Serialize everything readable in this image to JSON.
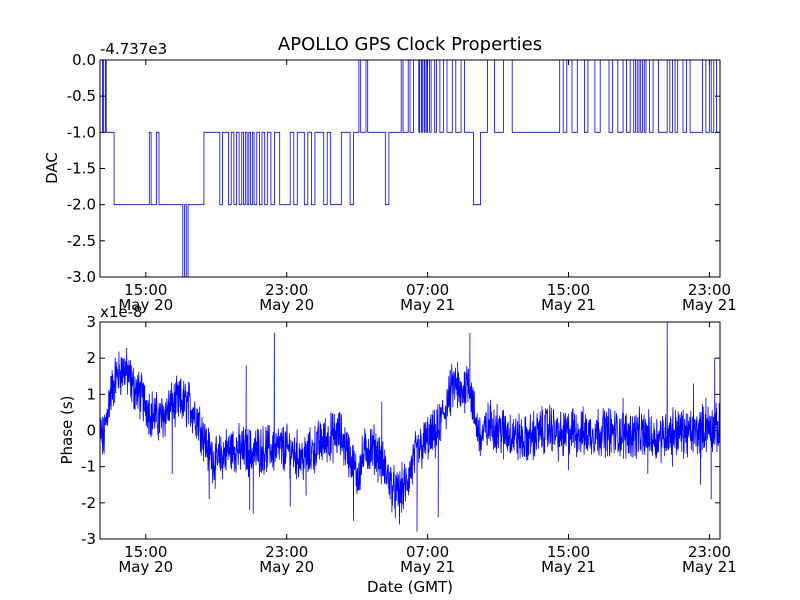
{
  "figure": {
    "title": "APOLLO GPS Clock Properties",
    "xlabel": "Date (GMT)"
  },
  "x_ticks": [
    {
      "time": "15:00",
      "date": "May 20",
      "hours": 15
    },
    {
      "time": "23:00",
      "date": "May 20",
      "hours": 23
    },
    {
      "time": "07:00",
      "date": "May 21",
      "hours": 31
    },
    {
      "time": "15:00",
      "date": "May 21",
      "hours": 39
    },
    {
      "time": "23:00",
      "date": "May 21",
      "hours": 47
    }
  ],
  "chart_data": [
    {
      "type": "line",
      "name": "dac-chart",
      "ylabel": "DAC",
      "offset_label": "-4.737e3",
      "xlim_hours": [
        12.4,
        47.6
      ],
      "ylim": [
        -3.0,
        0.0
      ],
      "yticks": [
        0.0,
        -0.5,
        -1.0,
        -1.5,
        -2.0,
        -2.5,
        -3.0
      ],
      "ytick_labels": [
        "0.0",
        "-0.5",
        "-1.0",
        "-1.5",
        "-2.0",
        "-2.5",
        "-3.0"
      ],
      "color": "#0000ff",
      "steps": [
        [
          12.4,
          -1
        ],
        [
          12.55,
          0
        ],
        [
          12.6,
          -1
        ],
        [
          12.7,
          0
        ],
        [
          12.75,
          -1
        ],
        [
          13.2,
          -2
        ],
        [
          15.2,
          -1
        ],
        [
          15.3,
          -2
        ],
        [
          15.6,
          -1
        ],
        [
          15.75,
          -2
        ],
        [
          17.1,
          -3
        ],
        [
          17.2,
          -2
        ],
        [
          17.3,
          -3
        ],
        [
          17.4,
          -2
        ],
        [
          18.3,
          -1
        ],
        [
          19.2,
          -2
        ],
        [
          19.35,
          -1
        ],
        [
          19.7,
          -2
        ],
        [
          19.85,
          -1
        ],
        [
          20.0,
          -2
        ],
        [
          20.15,
          -1
        ],
        [
          20.3,
          -2
        ],
        [
          20.45,
          -1
        ],
        [
          20.55,
          -2
        ],
        [
          20.65,
          -1
        ],
        [
          20.75,
          -2
        ],
        [
          20.85,
          -1
        ],
        [
          20.95,
          -2
        ],
        [
          21.05,
          -1
        ],
        [
          21.15,
          -2
        ],
        [
          21.3,
          -1
        ],
        [
          21.45,
          -2
        ],
        [
          21.6,
          -1
        ],
        [
          21.75,
          -2
        ],
        [
          21.9,
          -1
        ],
        [
          22.1,
          -2
        ],
        [
          22.3,
          -1
        ],
        [
          22.6,
          -2
        ],
        [
          23.2,
          -1
        ],
        [
          23.4,
          -2
        ],
        [
          23.6,
          -1
        ],
        [
          24.0,
          -2
        ],
        [
          24.2,
          -1
        ],
        [
          24.4,
          -2
        ],
        [
          24.6,
          -1
        ],
        [
          25.1,
          -2
        ],
        [
          25.3,
          -1
        ],
        [
          25.5,
          -2
        ],
        [
          26.1,
          -1
        ],
        [
          26.6,
          -2
        ],
        [
          26.8,
          -1
        ],
        [
          27.0,
          -1
        ],
        [
          27.1,
          0
        ],
        [
          27.2,
          -1
        ],
        [
          27.5,
          0
        ],
        [
          27.6,
          -1
        ],
        [
          28.6,
          -2
        ],
        [
          28.8,
          -1
        ],
        [
          29.5,
          0
        ],
        [
          29.6,
          -1
        ],
        [
          29.9,
          0
        ],
        [
          30.0,
          -1
        ],
        [
          30.2,
          0
        ],
        [
          30.5,
          -1
        ],
        [
          30.55,
          0
        ],
        [
          30.65,
          -1
        ],
        [
          30.7,
          0
        ],
        [
          30.8,
          -1
        ],
        [
          30.85,
          0
        ],
        [
          30.95,
          -1
        ],
        [
          31.0,
          0
        ],
        [
          31.1,
          -1
        ],
        [
          31.2,
          0
        ],
        [
          31.4,
          -1
        ],
        [
          31.5,
          0
        ],
        [
          31.7,
          -1
        ],
        [
          31.9,
          0
        ],
        [
          32.1,
          -1
        ],
        [
          32.4,
          0
        ],
        [
          32.6,
          -1
        ],
        [
          32.9,
          0
        ],
        [
          33.1,
          -1
        ],
        [
          33.6,
          -2
        ],
        [
          34.0,
          -1
        ],
        [
          34.4,
          0
        ],
        [
          34.8,
          -1
        ],
        [
          35.3,
          0
        ],
        [
          35.8,
          -1
        ],
        [
          38.5,
          0
        ],
        [
          38.7,
          -1
        ],
        [
          38.9,
          0
        ],
        [
          39.2,
          -1
        ],
        [
          39.5,
          0
        ],
        [
          39.9,
          -1
        ],
        [
          40.1,
          0
        ],
        [
          40.5,
          -1
        ],
        [
          40.8,
          0
        ],
        [
          41.3,
          -1
        ],
        [
          41.5,
          0
        ],
        [
          41.8,
          -1
        ],
        [
          42.1,
          0
        ],
        [
          42.3,
          -1
        ],
        [
          42.5,
          0
        ],
        [
          42.7,
          -1
        ],
        [
          42.8,
          0
        ],
        [
          42.9,
          -1
        ],
        [
          43.0,
          0
        ],
        [
          43.1,
          -1
        ],
        [
          43.2,
          0
        ],
        [
          43.3,
          -1
        ],
        [
          43.4,
          0
        ],
        [
          43.6,
          -1
        ],
        [
          43.8,
          0
        ],
        [
          44.1,
          -1
        ],
        [
          44.6,
          0
        ],
        [
          44.75,
          -1
        ],
        [
          44.9,
          0
        ],
        [
          45.05,
          -1
        ],
        [
          45.2,
          0
        ],
        [
          45.5,
          -1
        ],
        [
          45.7,
          0
        ],
        [
          45.9,
          -1
        ],
        [
          46.6,
          0
        ],
        [
          46.8,
          -1
        ],
        [
          47.0,
          0
        ],
        [
          47.1,
          -1
        ],
        [
          47.25,
          0
        ],
        [
          47.4,
          -1
        ],
        [
          47.6,
          -1
        ]
      ]
    },
    {
      "type": "line",
      "name": "phase-chart",
      "ylabel": "Phase (s)",
      "offset_label": "x1e-8",
      "xlim_hours": [
        12.4,
        47.6
      ],
      "ylim": [
        -3,
        3
      ],
      "yticks": [
        3,
        2,
        1,
        0,
        -1,
        -2,
        -3
      ],
      "ytick_labels": [
        "3",
        "2",
        "1",
        "0",
        "-1",
        "-2",
        "-3"
      ],
      "color": "#0000ff",
      "trend": [
        [
          12.4,
          0
        ],
        [
          12.6,
          -0.3
        ],
        [
          12.9,
          0.8
        ],
        [
          13.3,
          1.5
        ],
        [
          13.8,
          1.7
        ],
        [
          14.3,
          1.2
        ],
        [
          14.8,
          0.9
        ],
        [
          15.3,
          0.5
        ],
        [
          15.8,
          0.3
        ],
        [
          16.3,
          0.6
        ],
        [
          16.9,
          0.8
        ],
        [
          17.5,
          0.7
        ],
        [
          18.0,
          0.3
        ],
        [
          18.5,
          -0.5
        ],
        [
          19.0,
          -0.9
        ],
        [
          19.5,
          -0.6
        ],
        [
          20.0,
          -0.5
        ],
        [
          21.0,
          -0.6
        ],
        [
          22.0,
          -0.5
        ],
        [
          23.0,
          -0.5
        ],
        [
          24.0,
          -0.8
        ],
        [
          25.0,
          -0.3
        ],
        [
          26.0,
          -0.1
        ],
        [
          26.5,
          -0.6
        ],
        [
          27.0,
          -1.3
        ],
        [
          27.5,
          -0.5
        ],
        [
          28.0,
          -0.5
        ],
        [
          28.5,
          -1.0
        ],
        [
          29.2,
          -1.8
        ],
        [
          29.8,
          -1.5
        ],
        [
          30.3,
          -0.7
        ],
        [
          30.9,
          -0.3
        ],
        [
          31.5,
          -0.1
        ],
        [
          32.0,
          0.6
        ],
        [
          32.5,
          1.3
        ],
        [
          32.9,
          0.9
        ],
        [
          33.3,
          1.5
        ],
        [
          33.7,
          0.3
        ],
        [
          34.0,
          -0.2
        ],
        [
          34.6,
          0.2
        ],
        [
          35.2,
          0.0
        ],
        [
          35.8,
          -0.1
        ],
        [
          36.5,
          -0.3
        ],
        [
          37.2,
          -0.1
        ],
        [
          38.0,
          0.1
        ],
        [
          38.5,
          -0.2
        ],
        [
          39.2,
          0.0
        ],
        [
          40.0,
          -0.1
        ],
        [
          41.0,
          0.0
        ],
        [
          42.0,
          -0.1
        ],
        [
          43.0,
          -0.1
        ],
        [
          44.0,
          -0.2
        ],
        [
          45.0,
          0.0
        ],
        [
          46.0,
          -0.1
        ],
        [
          47.0,
          0.1
        ],
        [
          47.6,
          0.0
        ]
      ],
      "spikes": [
        [
          13.6,
          2.0
        ],
        [
          16.5,
          -1.2
        ],
        [
          18.6,
          -1.9
        ],
        [
          20.7,
          1.8
        ],
        [
          20.9,
          -2.2
        ],
        [
          21.1,
          -2.3
        ],
        [
          22.3,
          2.7
        ],
        [
          23.2,
          -2.1
        ],
        [
          24.1,
          -1.8
        ],
        [
          26.8,
          -2.5
        ],
        [
          28.4,
          0.8
        ],
        [
          29.4,
          -2.6
        ],
        [
          30.4,
          -2.8
        ],
        [
          31.6,
          -2.4
        ],
        [
          32.7,
          1.9
        ],
        [
          33.4,
          2.7
        ],
        [
          35.3,
          -0.8
        ],
        [
          37.8,
          0.6
        ],
        [
          39.0,
          -1.1
        ],
        [
          42.1,
          0.9
        ],
        [
          43.5,
          -1.2
        ],
        [
          44.6,
          3.0
        ],
        [
          44.9,
          -1.0
        ],
        [
          46.1,
          1.3
        ],
        [
          46.5,
          -1.5
        ],
        [
          46.8,
          0.9
        ],
        [
          47.3,
          2.0
        ],
        [
          47.1,
          -1.9
        ]
      ]
    }
  ]
}
